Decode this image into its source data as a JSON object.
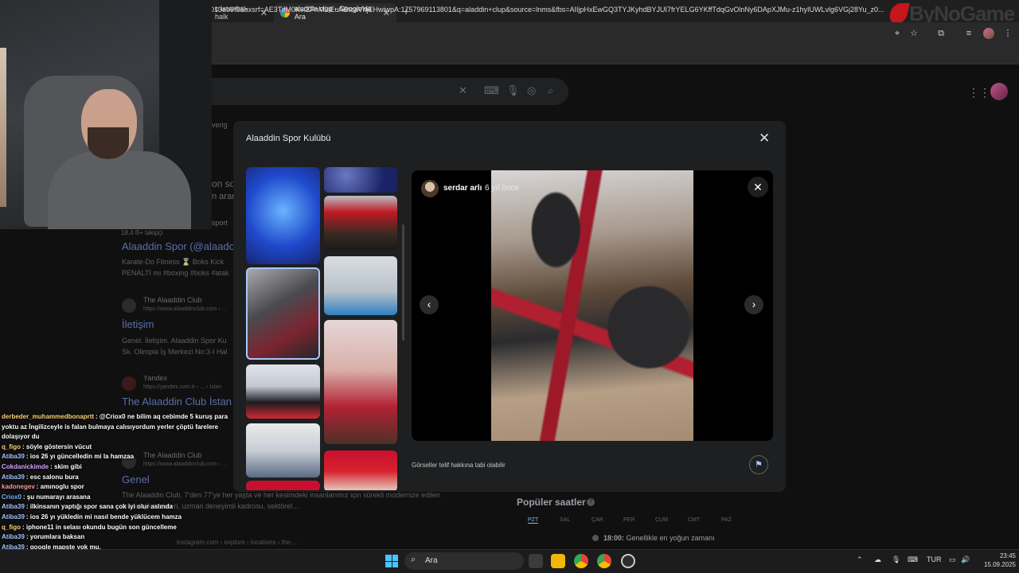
{
  "browser": {
    "tabs": [
      {
        "label": "o istanbul-halk",
        "active": false
      },
      {
        "label": "aladdin clup - Google'da Ara",
        "active": true
      }
    ],
    "new_tab": "+",
    "url": "013eb9f8&sxsrf=AE3TifM0KvIZFnM2iEuABtcaVhjEHwiwpA:1757969113801&q=aladdin+clup&source=lnms&fbs=AIIjpHxEwGQ3TYJKyhdBYJUI7frYELG6YKffTdqGvOlnNy6DApXJMu-z1hyIUWLvlg6VGj28Yu_z0...",
    "brand_logo": "ByNoGame"
  },
  "results": {
    "tab_fragment": "verig",
    "snippet_fragment1": "on so",
    "snippet_fragment2": "n aram",
    "snippet_fragment3": "sport",
    "followers": "18,4 B+ takipçi",
    "result1": {
      "link": "Alaaddin Spor (@alaado",
      "snippet": "Karate-Do Fitness ⌛ Boks Kick PENALTI mı #boxing #boks #atak"
    },
    "result2": {
      "site": "The Alaaddin Club",
      "url": "https://www.alaaddinclub.com › ...",
      "link": "İletişim",
      "snippet": "Genel. İletişim. Alaaddin Spor Ku Sk. Olimpia İş Merkezi No:3-I Hal"
    },
    "result3": {
      "site": "Yandex",
      "url": "https://yandex.com.tr › ... › İstan",
      "link": "The Alaaddin Club İstan"
    },
    "result4": {
      "site": "The Alaaddin Club",
      "url": "https://www.alaaddinclub.com › ...",
      "link": "Genel",
      "snippet": "The Alaaddin Club, 7'den 77'ye her yaşta ve her kesimdeki insanlarımız için sürekli modernize edilen teknolojik tesisleri, uzman deneyimli kadrosu, sektörel…"
    },
    "result5_url": "instagram.com › explore › locations › the-..."
  },
  "modal": {
    "title": "Alaaddin Spor Kulübü",
    "close": "✕",
    "poster_name": "serdar arlı",
    "poster_time": "6 yıl önce",
    "copyright": "Görseller telif hakkına tabi olabilir"
  },
  "popular": {
    "title": "Popüler saatler",
    "days": [
      "PZT",
      "SAL",
      "ÇAR",
      "PER",
      "CUM",
      "CMT",
      "PAZ"
    ],
    "time": "18:00:",
    "note": "Genellikle en yoğun zamanı"
  },
  "chat": [
    {
      "user": "derbeder_muhammedbonaprtt",
      "color": "#ffd27a",
      "msg": ": @Criox0 ne bilim aq cebimde 5 kuruş para yoktu az İngilizceyle is falan bulmaya calısıyordum yerler çöptü farelere dolaşıyor du"
    },
    {
      "user": "q_figo",
      "color": "#ffd27a",
      "msg": ": söyle göstersin vücut"
    },
    {
      "user": "Atiba39",
      "color": "#a8c8ff",
      "msg": ": ios 26 yı güncelledin mi la hamzaa"
    },
    {
      "user": "Cokdanickimde",
      "color": "#d6a8ff",
      "msg": ": skim gibi"
    },
    {
      "user": "Atiba39",
      "color": "#a8c8ff",
      "msg": ": esc salonu bura"
    },
    {
      "user": "kadonegev",
      "color": "#ff9b9b",
      "msg": ": amınoglu spor"
    },
    {
      "user": "Criox0",
      "color": "#7ab8ff",
      "msg": ": şu numarayı arasana"
    },
    {
      "user": "Atiba39",
      "color": "#a8c8ff",
      "msg": ": ilkinsanın yaptığı spor sana çok iyi olur aslında"
    },
    {
      "user": "Atiba39",
      "color": "#a8c8ff",
      "msg": ": ios 26 yı yükledin mi nasıl bende yüklücem hamza"
    },
    {
      "user": "q_figo",
      "color": "#ffd27a",
      "msg": ": iphone11 in selası okundu bugün son güncelleme"
    },
    {
      "user": "Atiba39",
      "color": "#a8c8ff",
      "msg": ": yorumlara baksan"
    },
    {
      "user": "Atiba39",
      "color": "#a8c8ff",
      "msg": ": google mapste yok mu,"
    }
  ],
  "taskbar": {
    "search": "Ara",
    "lang": "TUR",
    "time": "23:45",
    "date": "15.09.2025"
  }
}
